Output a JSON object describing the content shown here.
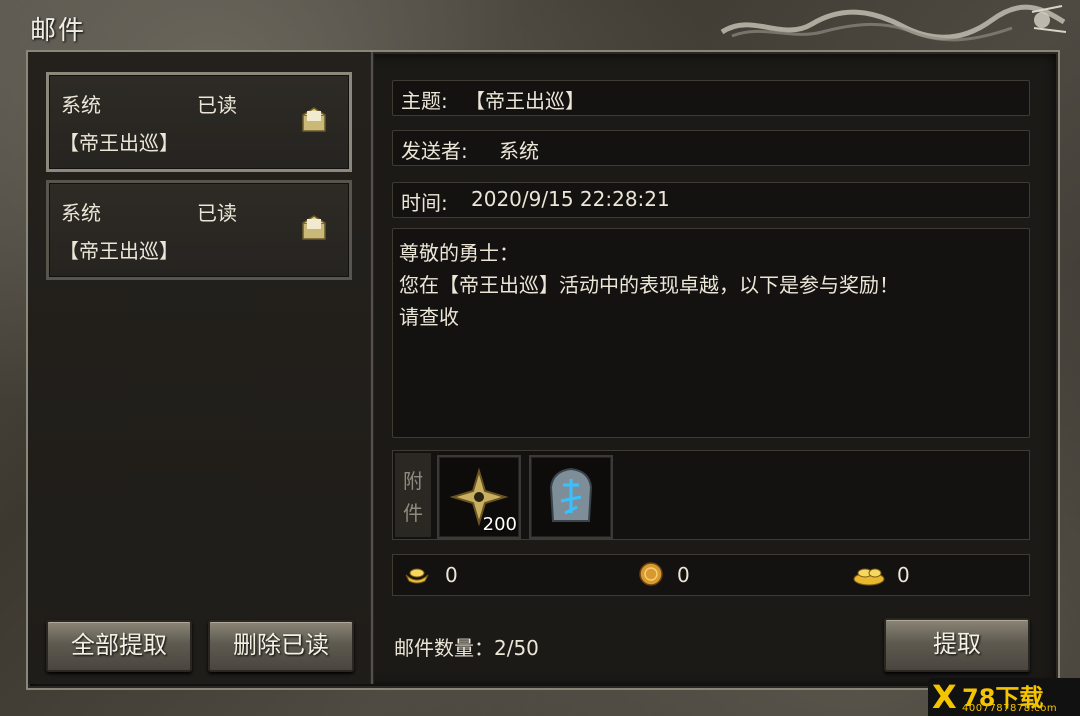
{
  "window": {
    "title": "邮件"
  },
  "mail_list": [
    {
      "sender": "系统",
      "status": "已读",
      "subject": "【帝王出巡】",
      "icon": "envelope-open-icon"
    },
    {
      "sender": "系统",
      "status": "已读",
      "subject": "【帝王出巡】",
      "icon": "envelope-open-icon"
    }
  ],
  "left_buttons": {
    "collect_all": "全部提取",
    "delete_read": "删除已读"
  },
  "detail": {
    "subject_label": "主题:",
    "subject_value": "【帝王出巡】",
    "sender_label": "发送者:",
    "sender_value": "系统",
    "time_label": "时间:",
    "time_value": "2020/9/15 22:28:21",
    "body_lines": [
      "尊敬的勇士：",
      "您在【帝王出巡】活动中的表现卓越，以下是参与奖励！",
      "请查收"
    ]
  },
  "attachments": {
    "label_chars": [
      "附",
      "件"
    ],
    "items": [
      {
        "icon": "shuriken-icon",
        "quantity": "200"
      },
      {
        "icon": "rune-stone-icon",
        "quantity": ""
      }
    ]
  },
  "currencies": [
    {
      "icon": "gold-ingot-icon",
      "value": "0"
    },
    {
      "icon": "coin-icon",
      "value": "0"
    },
    {
      "icon": "gold-pile-icon",
      "value": "0"
    }
  ],
  "mail_count": "邮件数量：2/50",
  "collect_button": "提取",
  "watermark": {
    "main": "78下载",
    "sub": "4007787878.com",
    "x": "X"
  },
  "colors": {
    "accent_gold": "#f5c400",
    "text": "#ece6d8",
    "panel": "#131210"
  }
}
